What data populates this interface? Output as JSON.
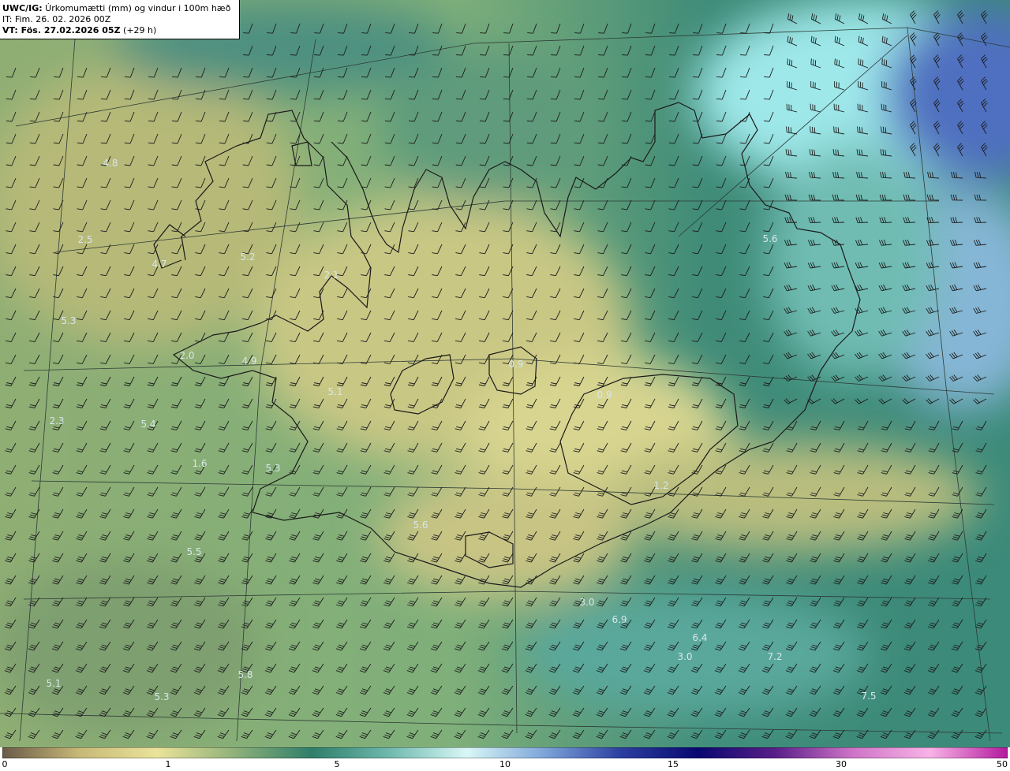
{
  "header": {
    "model": "UWC/IG:",
    "title": " Úrkomumætti (mm) og vindur i 100m hæð",
    "init_line": "IT: Fim. 26. 02. 2026 00Z",
    "valid_prefix": "VT: Fös. 27.02.2026 05Z",
    "valid_suffix": " (+29 h)"
  },
  "colorbar": {
    "ticks": [
      "0",
      "1",
      "5",
      "10",
      "15",
      "30",
      "50"
    ],
    "colors": [
      "#6b5a48",
      "#c7b978",
      "#eae39a",
      "#8fb17a",
      "#2f7e6a",
      "#6fb9ae",
      "#d8f7f6",
      "#7fa6da",
      "#2c3fa0",
      "#080870",
      "#5a1e88",
      "#cf74c7",
      "#f8b3e7",
      "#b3199d"
    ]
  },
  "map_labels": [
    {
      "text": "4.8"
    },
    {
      "text": "2.5"
    },
    {
      "text": "5.2"
    },
    {
      "text": "4.7"
    },
    {
      "text": "2.1"
    },
    {
      "text": "5.3"
    },
    {
      "text": "2.0"
    },
    {
      "text": "4.9"
    },
    {
      "text": "5.1"
    },
    {
      "text": "2.3"
    },
    {
      "text": "5.4"
    },
    {
      "text": "1.6"
    },
    {
      "text": "5.3"
    },
    {
      "text": "0.9"
    },
    {
      "text": "0.9"
    },
    {
      "text": "1.2"
    },
    {
      "text": "5.6"
    },
    {
      "text": "5.5"
    },
    {
      "text": "5.6"
    },
    {
      "text": "3.0"
    },
    {
      "text": "6.9"
    },
    {
      "text": "6.4"
    },
    {
      "text": "3.0"
    },
    {
      "text": "7.2"
    },
    {
      "text": "5.8"
    },
    {
      "text": "5.1"
    },
    {
      "text": "5.3"
    },
    {
      "text": "7.5"
    }
  ]
}
